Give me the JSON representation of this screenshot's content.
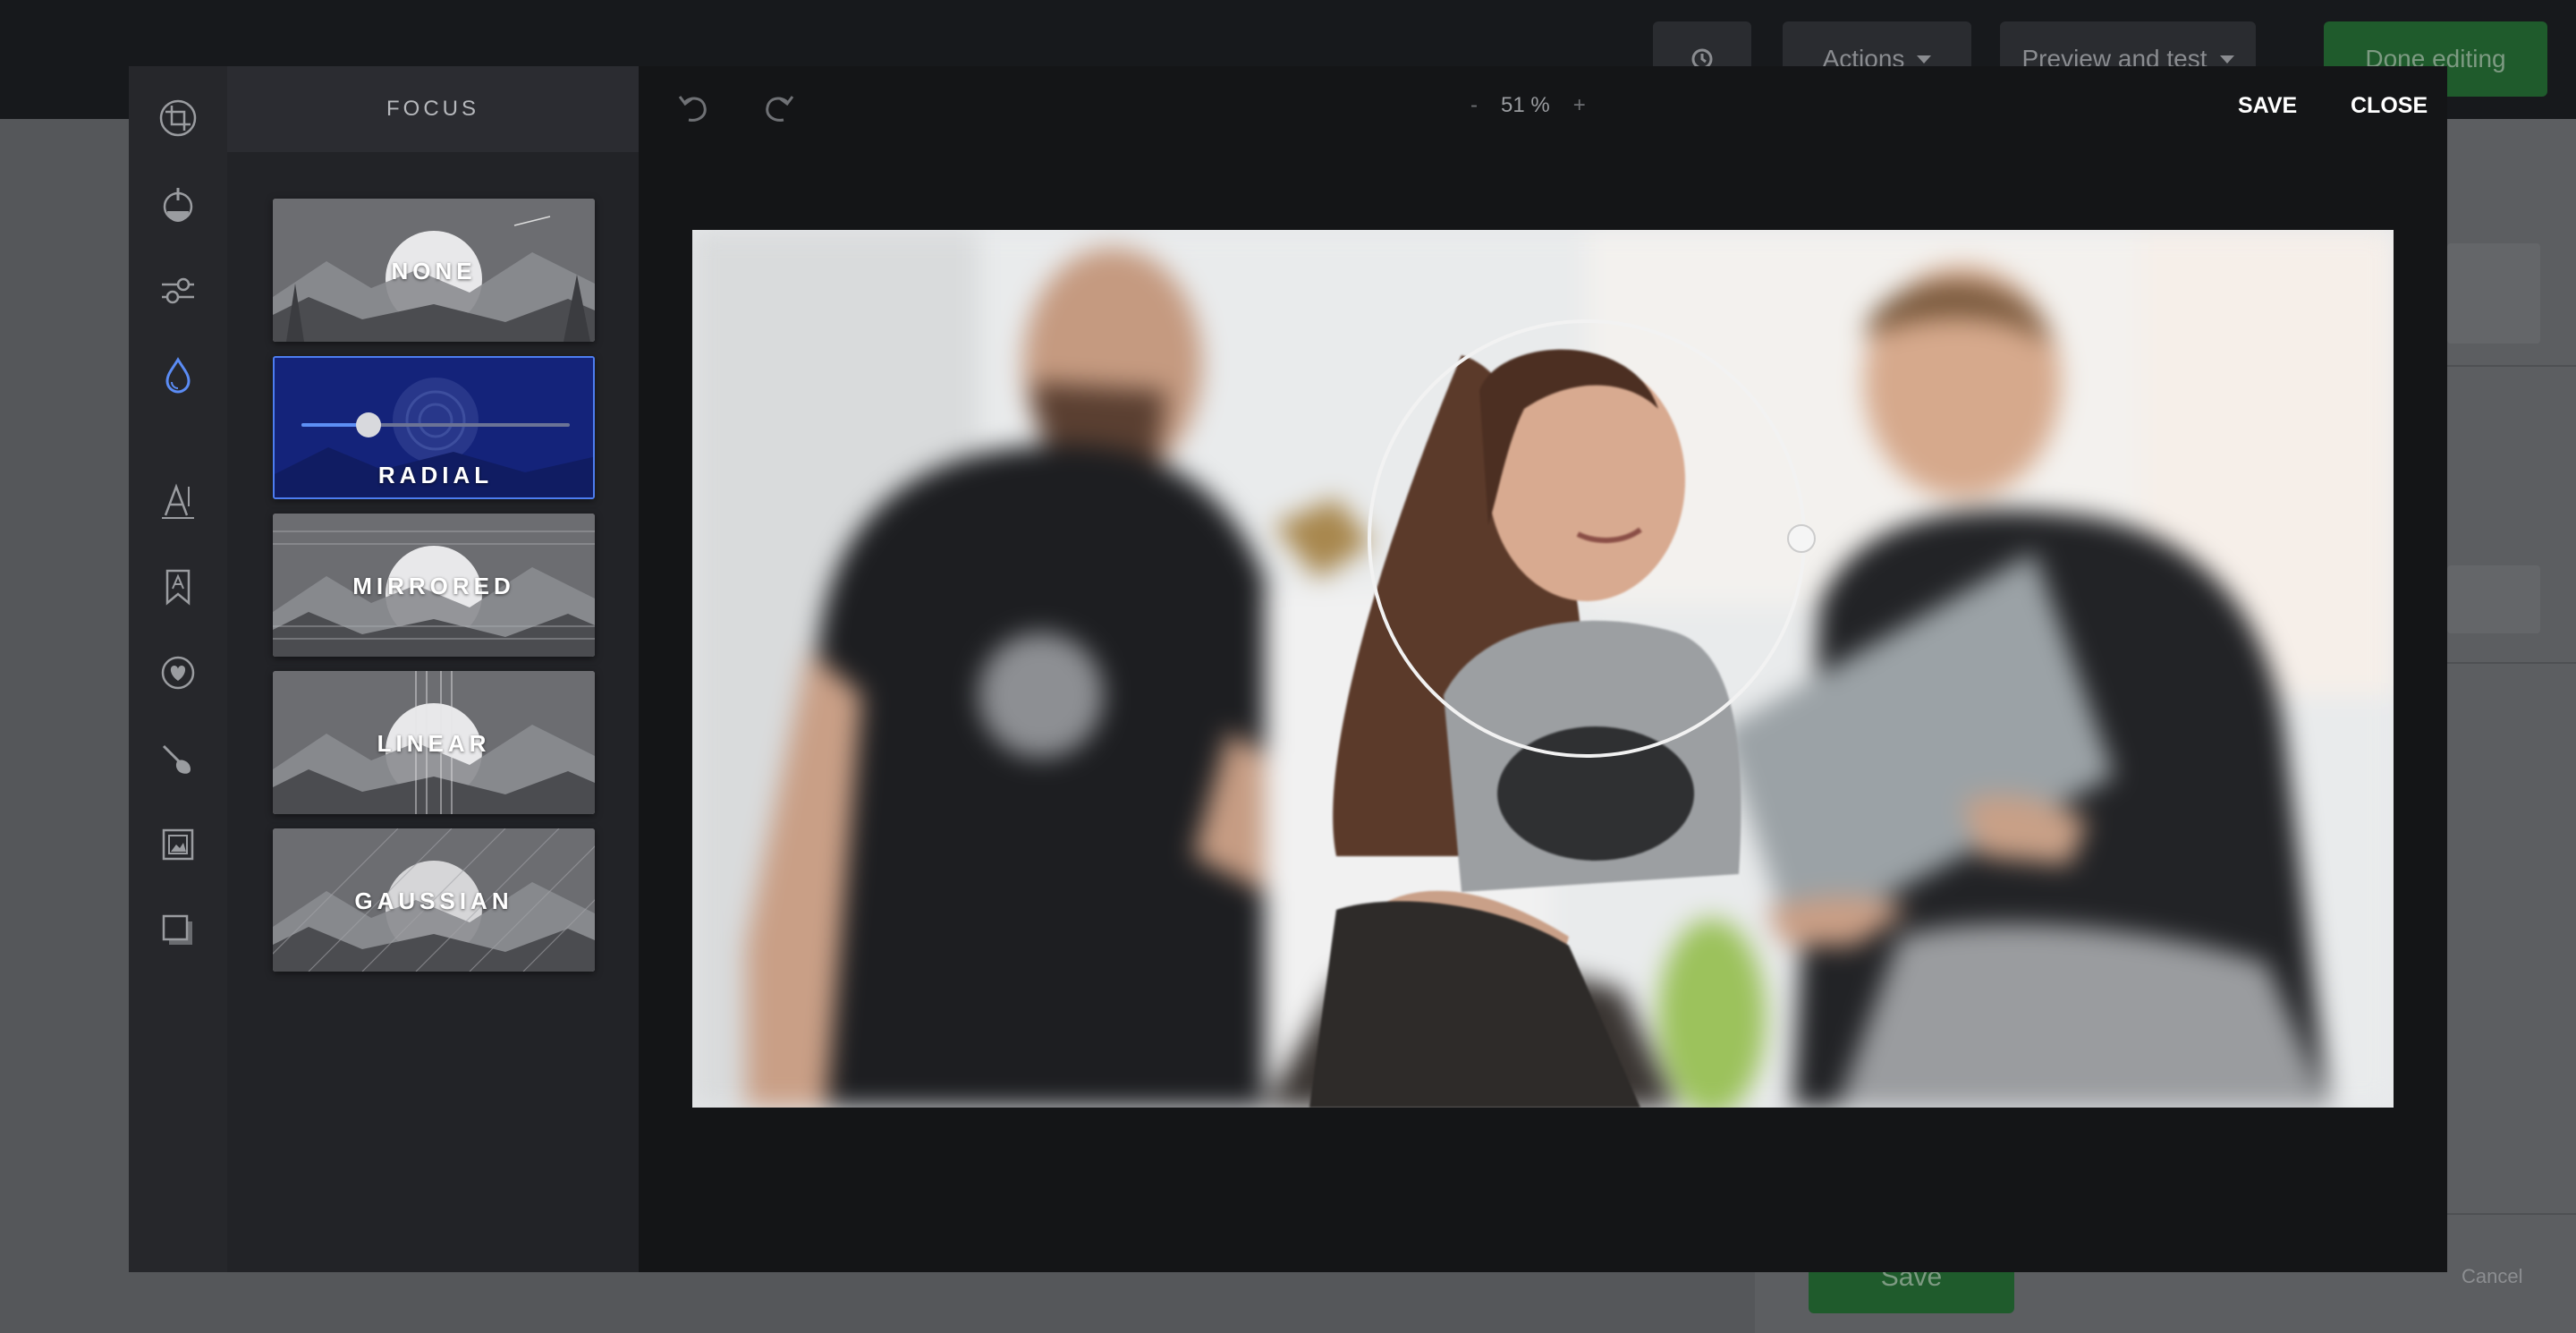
{
  "background": {
    "topbar": {
      "history_icon": "history-icon",
      "actions_label": "Actions",
      "preview_label": "Preview and test",
      "done_label": "Done editing"
    },
    "save_label": "Save",
    "cancel_label": "Cancel"
  },
  "editor": {
    "tools": [
      {
        "icon": "crop-icon"
      },
      {
        "icon": "filter-icon"
      },
      {
        "icon": "adjust-sliders-icon"
      },
      {
        "icon": "focus-drop-icon",
        "active": true
      },
      {
        "icon": "text-icon"
      },
      {
        "icon": "sticker-bookmark-icon"
      },
      {
        "icon": "heart-sticker-icon"
      },
      {
        "icon": "brush-icon"
      },
      {
        "icon": "frame-icon"
      },
      {
        "icon": "overlay-icon"
      }
    ],
    "panel_title": "FOCUS",
    "focus_options": [
      {
        "label": "NONE"
      },
      {
        "label": "RADIAL",
        "active": true,
        "intensity": 0.25
      },
      {
        "label": "MIRRORED"
      },
      {
        "label": "LINEAR"
      },
      {
        "label": "GAUSSIAN"
      }
    ],
    "zoom": {
      "minus": "-",
      "value": "51 %",
      "plus": "+"
    },
    "save_label": "SAVE",
    "close_label": "CLOSE",
    "accent_color": "#4d7df0"
  }
}
